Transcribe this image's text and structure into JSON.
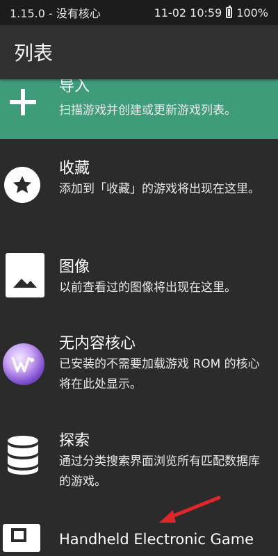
{
  "status_bar": {
    "version": "1.15.0 - 没有核心",
    "datetime": "11-02 10:59",
    "battery_percent": "100%",
    "battery_icon": "battery-icon"
  },
  "app_bar": {
    "title": "列表"
  },
  "list": {
    "items": [
      {
        "title": "导入",
        "desc": "扫描游戏并创建或更新游戏列表。",
        "icon": "plus-icon",
        "highlighted": true
      },
      {
        "title": "收藏",
        "desc": "添加到「收藏」的游戏将出现在这里。",
        "icon": "star-icon"
      },
      {
        "title": "图像",
        "desc": "以前查看过的图像将出现在这里。",
        "icon": "image-icon"
      },
      {
        "title": "无内容核心",
        "desc": "已安装的不需要加载游戏 ROM 的核心将在此处显示。",
        "icon": "app-icon"
      },
      {
        "title": "探索",
        "desc": "通过分类搜索界面浏览所有匹配数据库的游戏。",
        "icon": "database-icon"
      },
      {
        "title": "Handheld Electronic Game",
        "desc": "",
        "icon": "handheld-icon"
      }
    ]
  },
  "colors": {
    "highlight": "#3e9c7b",
    "background": "#2b2b2b",
    "annotation_arrow": "#e0262b"
  }
}
